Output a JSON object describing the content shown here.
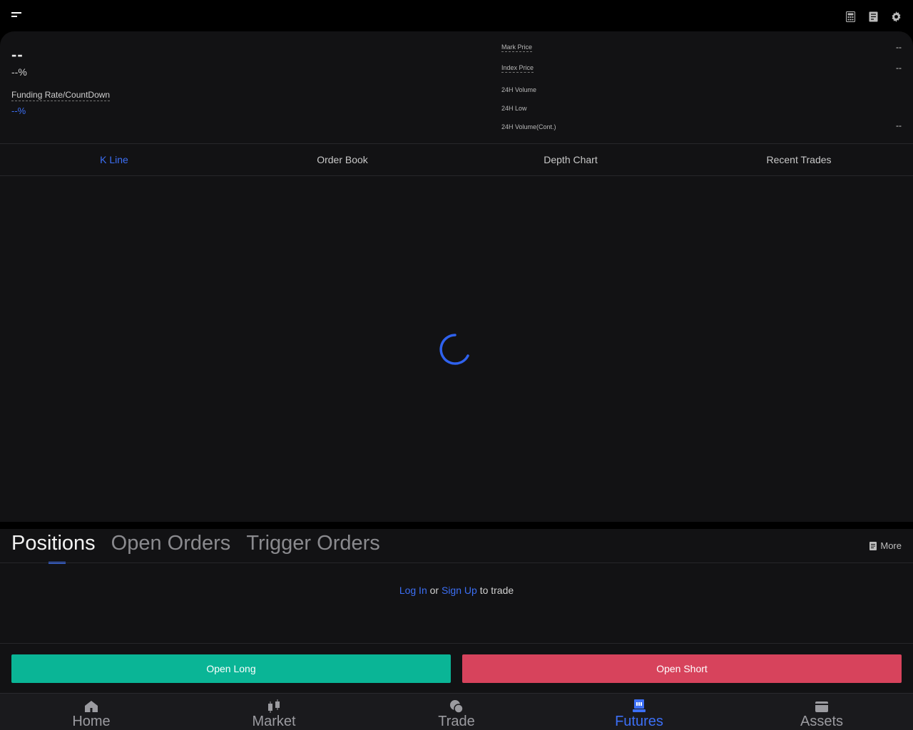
{
  "header": {
    "price": "--",
    "change": "--%",
    "funding_label": "Funding Rate/CountDown",
    "funding_value": "--%",
    "stats": [
      {
        "label": "Mark Price",
        "value": "--"
      },
      {
        "label": "Index Price",
        "value": "--"
      },
      {
        "label": "24H Volume",
        "value": ""
      },
      {
        "label": "24H Low",
        "value": ""
      },
      {
        "label": "24H Volume(Cont.)",
        "value": "--"
      }
    ]
  },
  "tabs": [
    {
      "label": "K Line",
      "active": true
    },
    {
      "label": "Order Book",
      "active": false
    },
    {
      "label": "Depth Chart",
      "active": false
    },
    {
      "label": "Recent Trades",
      "active": false
    }
  ],
  "positions": {
    "tabs": [
      "Positions",
      "Open Orders",
      "Trigger Orders"
    ],
    "more_label": "More",
    "login_link": "Log In",
    "or_text": "or",
    "signup_link": "Sign Up",
    "trade_text": "to trade"
  },
  "actions": {
    "open_long": "Open Long",
    "open_short": "Open Short"
  },
  "nav": [
    {
      "label": "Home",
      "icon": "home-icon"
    },
    {
      "label": "Market",
      "icon": "candlestick-icon"
    },
    {
      "label": "Trade",
      "icon": "trade-icon"
    },
    {
      "label": "Futures",
      "icon": "futures-icon",
      "active": true
    },
    {
      "label": "Assets",
      "icon": "wallet-icon"
    }
  ],
  "colors": {
    "accent": "#3c6ff5",
    "long": "#0ab596",
    "short": "#d7435c",
    "background": "#121214"
  }
}
